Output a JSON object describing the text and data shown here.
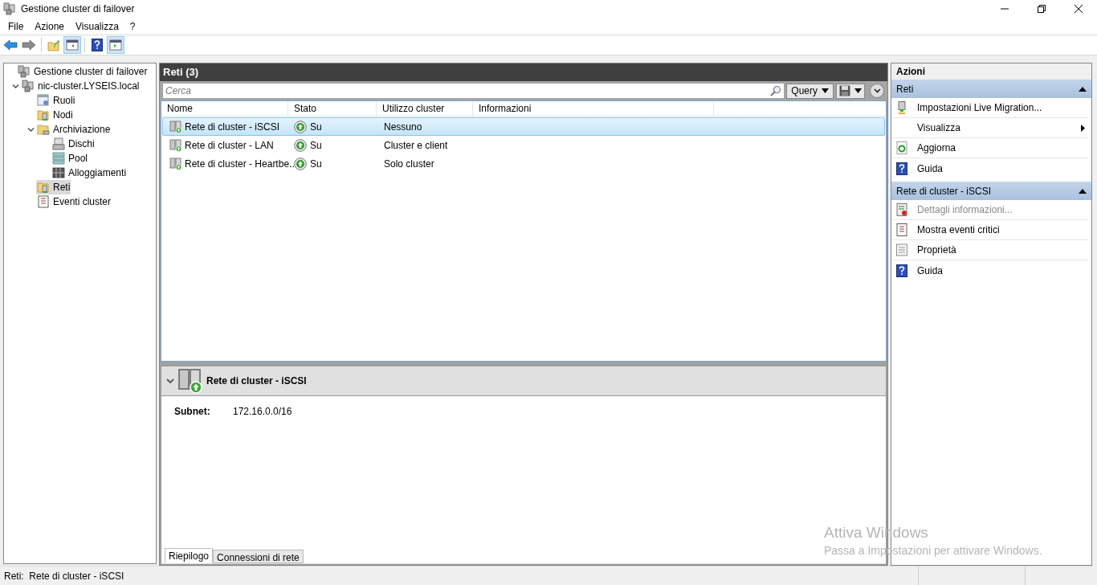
{
  "window": {
    "title": "Gestione cluster di failover"
  },
  "menu": [
    "File",
    "Azione",
    "Visualizza",
    "?"
  ],
  "toolbar": [
    {
      "kind": "back",
      "pressed": false
    },
    {
      "kind": "forward",
      "pressed": false
    },
    {
      "kind": "up",
      "pressed": false
    },
    {
      "kind": "tree-pane",
      "pressed": true
    },
    {
      "kind": "help",
      "pressed": false
    },
    {
      "kind": "action-pane",
      "pressed": true
    }
  ],
  "tree": [
    {
      "label": "Gestione cluster di failover",
      "kind": "cluster",
      "selected": false,
      "children": [
        {
          "label": "nic-cluster.LYSEIS.local",
          "kind": "cluster",
          "selected": false,
          "expanded": true,
          "children": [
            {
              "label": "Ruoli",
              "kind": "roles",
              "selected": false
            },
            {
              "label": "Nodi",
              "kind": "folder-server",
              "selected": false
            },
            {
              "label": "Archiviazione",
              "kind": "folder",
              "selected": false,
              "expanded": true,
              "children": [
                {
                  "label": "Dischi",
                  "kind": "disk",
                  "selected": false
                },
                {
                  "label": "Pool",
                  "kind": "pool",
                  "selected": false
                },
                {
                  "label": "Alloggiamenti",
                  "kind": "enclosure",
                  "selected": false
                }
              ]
            },
            {
              "label": "Reti",
              "kind": "folder-server",
              "selected": true
            },
            {
              "label": "Eventi cluster",
              "kind": "log",
              "selected": false
            }
          ]
        }
      ]
    }
  ],
  "center": {
    "title": "Reti (3)",
    "search": {
      "placeholder": "Cerca"
    },
    "query_button": "Query",
    "columns": [
      "Nome",
      "Stato",
      "Utilizzo cluster",
      "Informazioni"
    ],
    "rows": [
      {
        "name": "Rete di cluster - iSCSI",
        "status": "Su",
        "usage": "Nessuno",
        "selected": true
      },
      {
        "name": "Rete di cluster - LAN",
        "status": "Su",
        "usage": "Cluster e client",
        "selected": false
      },
      {
        "name": "Rete di cluster - Heartbe...",
        "status": "Su",
        "usage": "Solo cluster",
        "selected": false
      }
    ],
    "details": {
      "title": "Rete di cluster - iSCSI",
      "expanded": true,
      "fields": [
        {
          "label": "Subnet:",
          "value": "172.16.0.0/16"
        }
      ],
      "tabs": [
        {
          "label": "Riepilogo",
          "selected": true
        },
        {
          "label": "Connessioni di rete",
          "selected": false
        }
      ]
    }
  },
  "actions": {
    "title": "Azioni",
    "sections": [
      {
        "title": "Reti",
        "expanded": true,
        "items": [
          {
            "label": "Impostazioni Live Migration...",
            "kind": "migration",
            "disabled": false,
            "submenu": false
          },
          {
            "label": "Visualizza",
            "kind": "none",
            "disabled": false,
            "submenu": true
          },
          {
            "label": "Aggiorna",
            "kind": "refresh",
            "disabled": false,
            "submenu": false
          },
          {
            "label": "Guida",
            "kind": "help",
            "disabled": false,
            "submenu": false
          }
        ]
      },
      {
        "title": "Rete di cluster - iSCSI",
        "expanded": true,
        "items": [
          {
            "label": "Dettagli informazioni...",
            "kind": "info",
            "disabled": true,
            "submenu": false
          },
          {
            "label": "Mostra eventi critici",
            "kind": "log",
            "disabled": false,
            "submenu": false
          },
          {
            "label": "Proprietà",
            "kind": "properties",
            "disabled": false,
            "submenu": false
          },
          {
            "label": "Guida",
            "kind": "help",
            "disabled": false,
            "submenu": false
          }
        ]
      }
    ]
  },
  "status_bar": "Reti:  Rete di cluster - iSCSI",
  "activation": {
    "title": "Attiva Windows",
    "text": "Passa a Impostazioni per attivare Windows."
  }
}
